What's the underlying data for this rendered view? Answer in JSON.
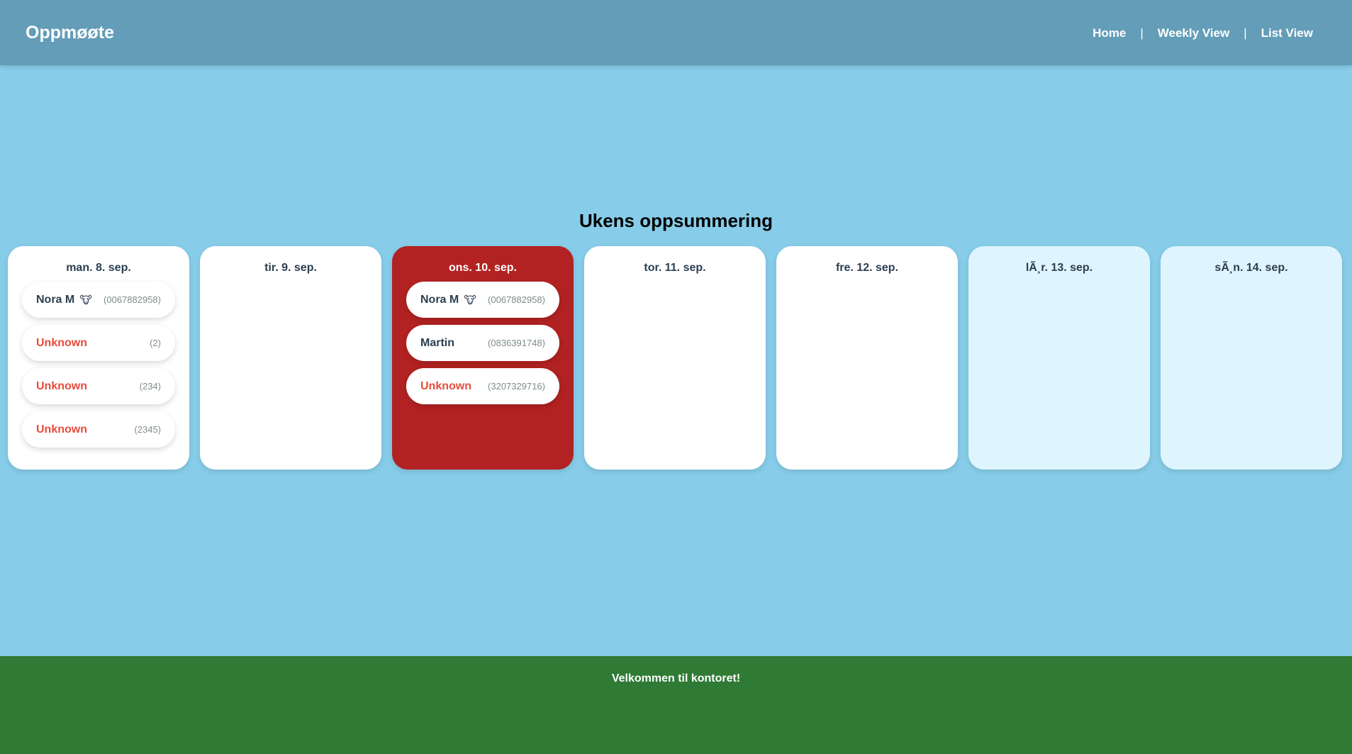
{
  "app": {
    "brand": "Oppmøøte"
  },
  "nav": {
    "home": "Home",
    "weekly": "Weekly View",
    "list": "List View",
    "separator": "|"
  },
  "summary": {
    "title": "Ukens oppsummering"
  },
  "days": [
    {
      "label": "man. 8. sep.",
      "entries": [
        {
          "name": "Nora M",
          "icon": "cow-icon",
          "id": "(0067882958)",
          "unknown": false
        },
        {
          "name": "Unknown",
          "id": "(2)",
          "unknown": true
        },
        {
          "name": "Unknown",
          "id": "(234)",
          "unknown": true
        },
        {
          "name": "Unknown",
          "id": "(2345)",
          "unknown": true
        }
      ]
    },
    {
      "label": "tir. 9. sep.",
      "entries": []
    },
    {
      "label": "ons. 10. sep.",
      "entries": [
        {
          "name": "Nora M",
          "icon": "cow-icon",
          "id": "(0067882958)",
          "unknown": false
        },
        {
          "name": "Martin",
          "id": "(0836391748)",
          "unknown": false
        },
        {
          "name": "Unknown",
          "id": "(3207329716)",
          "unknown": true
        }
      ]
    },
    {
      "label": "tor. 11. sep.",
      "entries": []
    },
    {
      "label": "fre. 12. sep.",
      "entries": []
    },
    {
      "label": "lÃ¸r. 13. sep.",
      "entries": []
    },
    {
      "label": "sÃ¸n. 14. sep.",
      "entries": []
    }
  ],
  "footer": {
    "text": "Velkommen til kontoret!"
  },
  "colors": {
    "header": "#639db8",
    "background": "#87cdea",
    "today": "#b22222",
    "weekend": "#dff5fd",
    "unknown": "#e74c3c",
    "footer": "#2f7a35"
  }
}
